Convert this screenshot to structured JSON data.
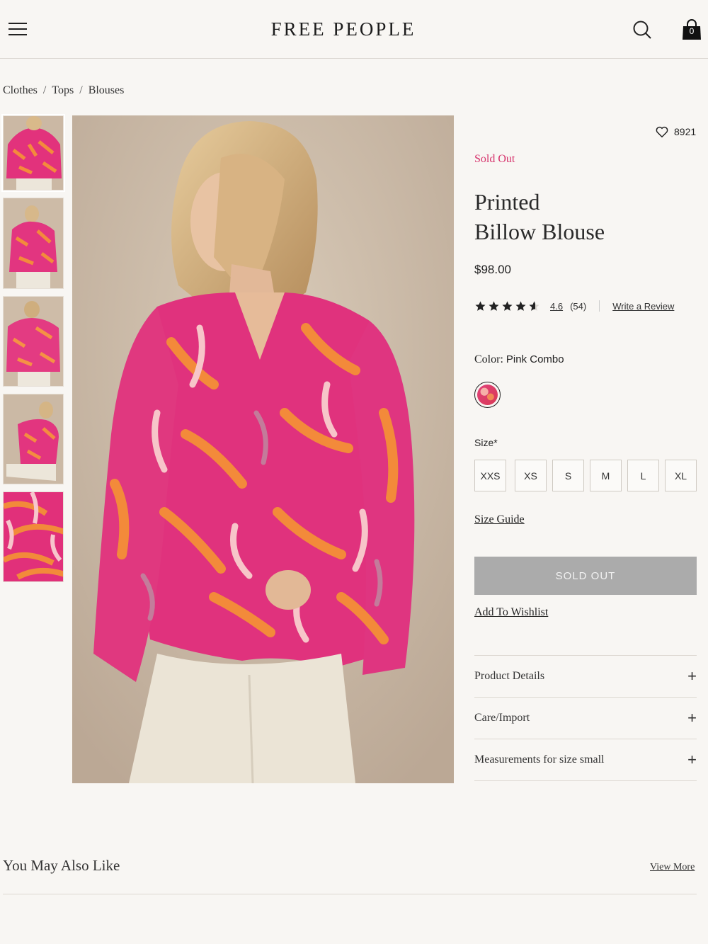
{
  "header": {
    "brand": "FREE PEOPLE",
    "cart_count": "0",
    "menu_icon": "hamburger-menu-icon",
    "search_icon": "search-icon",
    "cart_icon": "shopping-bag-icon"
  },
  "breadcrumb": [
    "Clothes",
    "Tops",
    "Blouses"
  ],
  "breadcrumb_separator": "/",
  "gallery": {
    "thumbnail_count": 5
  },
  "product": {
    "wishlist_count": "8921",
    "status": "Sold Out",
    "title_line1": "Printed",
    "title_line2": "Billow Blouse",
    "price": "$98.00",
    "rating_value": "4.6",
    "rating_stars": 4.6,
    "rating_count": "(54)",
    "write_review": "Write a Review",
    "color_label": "Color:",
    "color_value": "Pink Combo",
    "size_label": "Size*",
    "sizes": [
      "XXS",
      "XS",
      "S",
      "M",
      "L",
      "XL"
    ],
    "size_guide": "Size Guide",
    "cta": "SOLD OUT",
    "add_to_wishlist": "Add To Wishlist"
  },
  "accordion": [
    {
      "label": "Product Details"
    },
    {
      "label": "Care/Import"
    },
    {
      "label": "Measurements for size small"
    }
  ],
  "accordion_symbol": "+",
  "recommendations": {
    "title": "You May Also Like",
    "view_more": "View More"
  },
  "colors": {
    "accent_sold": "#d6336c",
    "sold_button": "#ababab",
    "print_pink": "#e1307a",
    "print_orange": "#f28a3a"
  }
}
